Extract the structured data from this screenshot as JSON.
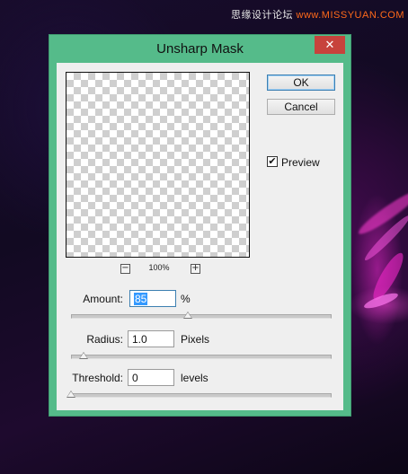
{
  "watermark": {
    "text": "思缘设计论坛",
    "url": "www.MISSYUAN.COM"
  },
  "dialog": {
    "title": "Unsharp Mask",
    "close_glyph": "✕",
    "buttons": {
      "ok": "OK",
      "cancel": "Cancel"
    },
    "preview_checkbox": {
      "label": "Preview",
      "checked": true,
      "check_glyph": "✔"
    },
    "zoom": {
      "minus": "−",
      "plus": "+",
      "level": "100%"
    },
    "fields": {
      "amount": {
        "label": "Amount:",
        "value": "85",
        "unit": "%",
        "slider_fraction": 0.45
      },
      "radius": {
        "label": "Radius:",
        "value": "1.0",
        "unit": "Pixels",
        "slider_fraction": 0.05
      },
      "threshold": {
        "label": "Threshold:",
        "value": "0",
        "unit": "levels",
        "slider_fraction": 0.0
      }
    }
  },
  "colors": {
    "frame": "#55bb8a",
    "close": "#c7433c",
    "selection": "#3399ff",
    "watermark_url": "#ff6a1a"
  }
}
